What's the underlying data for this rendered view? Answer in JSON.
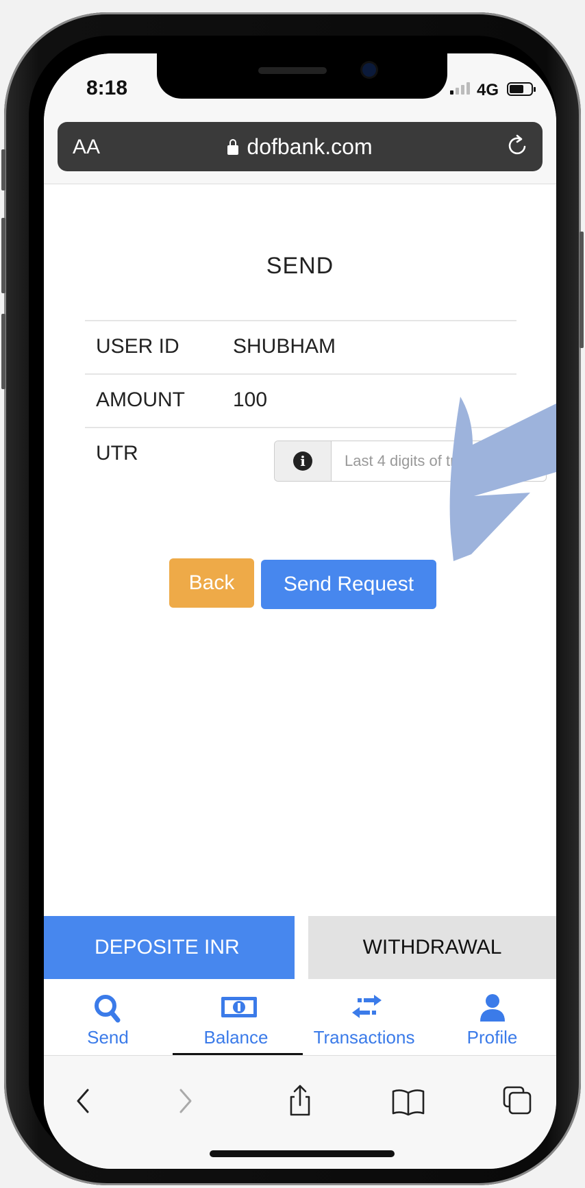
{
  "status": {
    "time": "8:18",
    "network": "4G"
  },
  "browser": {
    "text_size": "AA",
    "url": "dofbank.com"
  },
  "page": {
    "title": "SEND",
    "rows": [
      {
        "label": "USER ID",
        "value": "SHUBHAM"
      },
      {
        "label": "AMOUNT",
        "value": "100"
      },
      {
        "label": "UTR",
        "value": ""
      }
    ],
    "utr_placeholder": "Last 4 digits of transactio",
    "back_label": "Back",
    "send_label": "Send Request"
  },
  "tabs": {
    "deposit": "DEPOSITE INR",
    "withdrawal": "WITHDRAWAL"
  },
  "nav": [
    {
      "label": "Send",
      "icon": "search-icon"
    },
    {
      "label": "Balance",
      "icon": "money-icon"
    },
    {
      "label": "Transactions",
      "icon": "exchange-icon"
    },
    {
      "label": "Profile",
      "icon": "user-icon"
    }
  ],
  "colors": {
    "primary": "#4787ee",
    "back_button": "#eeaa48",
    "nav_text": "#3b7be9",
    "arrow": "#9db3dc"
  },
  "icons": {
    "toolbar": [
      "back-chevron-icon",
      "forward-chevron-icon",
      "share-icon",
      "bookmarks-icon",
      "tabs-icon"
    ]
  }
}
